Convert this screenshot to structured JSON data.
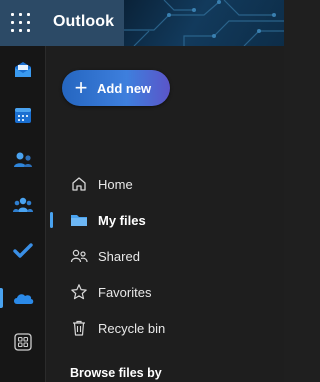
{
  "header": {
    "app_name": "Outlook",
    "waffle_icon": "app-launcher-icon"
  },
  "rail": {
    "items": [
      {
        "id": "mail",
        "icon": "mail-icon",
        "active": false
      },
      {
        "id": "calendar",
        "icon": "calendar-icon",
        "active": false
      },
      {
        "id": "people",
        "icon": "people-icon",
        "active": false
      },
      {
        "id": "groups",
        "icon": "groups-icon",
        "active": false
      },
      {
        "id": "todo",
        "icon": "checkmark-icon",
        "active": false
      },
      {
        "id": "onedrive",
        "icon": "cloud-icon",
        "active": true
      },
      {
        "id": "more-apps",
        "icon": "apps-grid-icon",
        "active": false
      }
    ]
  },
  "actions": {
    "add_new_label": "Add new"
  },
  "nav": {
    "items": [
      {
        "label": "Home",
        "icon": "home-icon",
        "selected": false
      },
      {
        "label": "My files",
        "icon": "folder-icon",
        "selected": true
      },
      {
        "label": "Shared",
        "icon": "shared-people-icon",
        "selected": false
      },
      {
        "label": "Favorites",
        "icon": "star-icon",
        "selected": false
      },
      {
        "label": "Recycle bin",
        "icon": "trash-icon",
        "selected": false
      }
    ]
  },
  "browse": {
    "heading": "Browse files by"
  },
  "colors": {
    "accent": "#4aa3f0",
    "brand_bar": "#2c4a66",
    "background": "#1e1e1e"
  }
}
